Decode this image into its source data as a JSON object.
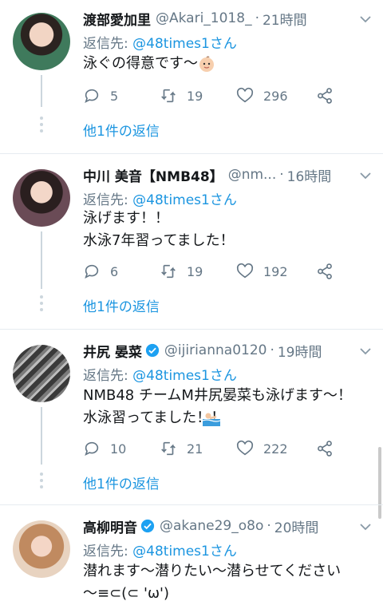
{
  "tweets": [
    {
      "name": "渡部愛加里",
      "handle": "@Akari_1018_",
      "time": "21時間",
      "reply_prefix": "返信先: ",
      "reply_to": "@48times1さん",
      "body_lines": [
        "泳ぐの得意です〜"
      ],
      "body_emoji": "baby-face-emoji",
      "replies": "5",
      "retweets": "19",
      "likes": "296",
      "more_replies": "他1件の返信",
      "verified": false,
      "avatar_color": "#3f7a5c"
    },
    {
      "name": "中川 美音【NMB48】",
      "handle": "@nm...",
      "time": "16時間",
      "reply_prefix": "返信先: ",
      "reply_to": "@48times1さん",
      "body_lines": [
        "泳げます！！",
        "水泳7年習ってました！"
      ],
      "replies": "6",
      "retweets": "19",
      "likes": "192",
      "more_replies": "他1件の返信",
      "verified": false,
      "avatar_color": "#4a3a3f"
    },
    {
      "name": "井尻 晏菜",
      "handle": "@ijirianna0120",
      "time": "19時間",
      "reply_prefix": "返信先: ",
      "reply_to": "@48times1さん",
      "body_lines": [
        "NMB48 チームM井尻晏菜も泳げます〜！",
        "水泳習ってました！！"
      ],
      "body_emoji": "swimmer-emoji",
      "replies": "10",
      "retweets": "21",
      "likes": "222",
      "more_replies": "他1件の返信",
      "verified": true,
      "avatar_color": "#555555"
    },
    {
      "name": "高柳明音",
      "handle": "@akane29_o8o",
      "time": "20時間",
      "reply_prefix": "返信先: ",
      "reply_to": "@48times1さん",
      "body_lines": [
        "潜れます〜潜りたい〜潜らせてください",
        "〜≡⊂(⊂ 'ω')"
      ],
      "verified": true,
      "avatar_color": "#b07a5a"
    }
  ],
  "colors": {
    "link": "#1b95e0",
    "muted": "#657786",
    "verified": "#1da1f2",
    "like_red": "#e0245e"
  }
}
